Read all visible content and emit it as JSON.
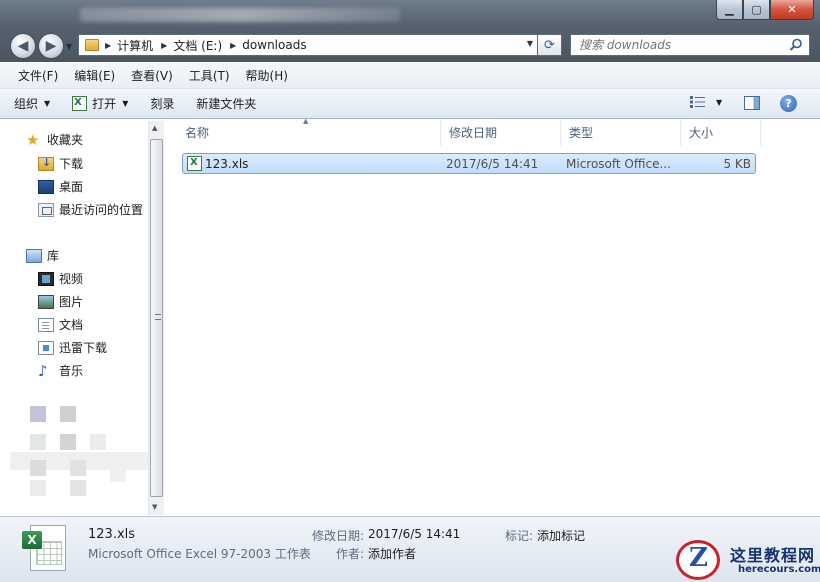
{
  "window": {
    "controls": {
      "minimize": "▁",
      "maximize": "▢",
      "close": "✕"
    }
  },
  "address": {
    "crumbs": [
      "计算机",
      "文档 (E:)",
      "downloads"
    ]
  },
  "search": {
    "placeholder": "搜索 downloads"
  },
  "menu": [
    "文件(F)",
    "编辑(E)",
    "查看(V)",
    "工具(T)",
    "帮助(H)"
  ],
  "toolbar": {
    "organize": "组织",
    "open": "打开",
    "burn": "刻录",
    "new_folder": "新建文件夹"
  },
  "sidebar": {
    "favorites": "收藏夹",
    "downloads": "下载",
    "desktop": "桌面",
    "recent": "最近访问的位置",
    "libraries": "库",
    "videos": "视频",
    "pictures": "图片",
    "documents": "文档",
    "xunlei": "迅雷下载",
    "music": "音乐"
  },
  "columns": {
    "name": "名称",
    "modified": "修改日期",
    "type": "类型",
    "size": "大小"
  },
  "files": [
    {
      "name": "123.xls",
      "modified": "2017/6/5 14:41",
      "type": "Microsoft Office...",
      "size": "5 KB"
    }
  ],
  "details": {
    "filename": "123.xls",
    "filetype": "Microsoft Office Excel 97-2003 工作表",
    "modified_label": "修改日期:",
    "modified_value": "2017/6/5 14:41",
    "tags_label": "标记:",
    "tags_value": "添加标记",
    "authors_label": "作者:",
    "authors_value": "添加作者"
  },
  "watermark": {
    "title": "这里教程网",
    "url": "herecours.com",
    "logo_letter": "Z"
  },
  "colors": {
    "accent": "#3a73c1",
    "selection": "#cce4fc",
    "close": "#c8381e"
  }
}
